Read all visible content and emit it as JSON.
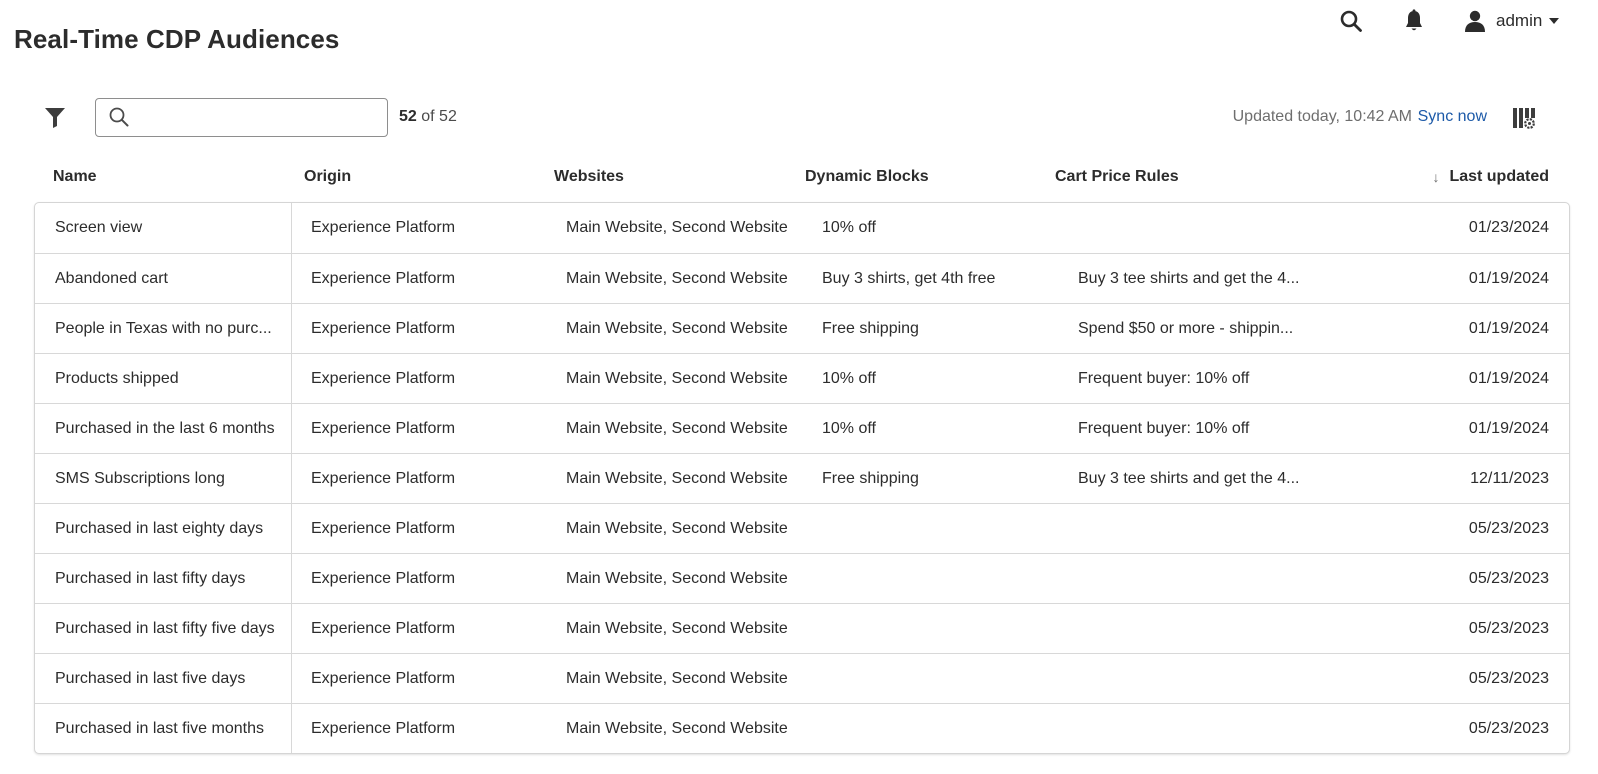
{
  "header": {
    "title": "Real-Time CDP Audiences",
    "icons": [
      "search-icon",
      "bell-icon",
      "user-icon"
    ],
    "user_name": "admin"
  },
  "toolbar": {
    "filter_icon": "filter-icon",
    "search": {
      "value": "",
      "placeholder": ""
    },
    "count_shown": "52",
    "count_total": "of 52",
    "updated_text": "Updated today, 10:42 AM",
    "sync_label": "Sync now",
    "column_settings_icon": "column-settings-icon"
  },
  "table": {
    "columns": [
      {
        "key": "name",
        "label": "Name"
      },
      {
        "key": "origin",
        "label": "Origin"
      },
      {
        "key": "websites",
        "label": "Websites"
      },
      {
        "key": "dynamic_blocks",
        "label": "Dynamic Blocks"
      },
      {
        "key": "cart_price_rules",
        "label": "Cart Price Rules"
      },
      {
        "key": "last_updated",
        "label": "Last updated",
        "sort": "descending"
      }
    ],
    "rows": [
      {
        "name": "Screen view",
        "origin": "Experience Platform",
        "websites": "Main Website, Second Website",
        "dynamic_blocks": "10% off",
        "cart_price_rules": "",
        "last_updated": "01/23/2024"
      },
      {
        "name": "Abandoned cart",
        "origin": "Experience Platform",
        "websites": "Main Website, Second Website",
        "dynamic_blocks": "Buy 3 shirts, get 4th free",
        "cart_price_rules": "Buy 3 tee shirts and get the 4...",
        "last_updated": "01/19/2024"
      },
      {
        "name": "People in Texas with no purc...",
        "origin": "Experience Platform",
        "websites": "Main Website, Second Website",
        "dynamic_blocks": "Free shipping",
        "cart_price_rules": "Spend $50 or more - shippin...",
        "last_updated": "01/19/2024"
      },
      {
        "name": "Products shipped",
        "origin": "Experience Platform",
        "websites": "Main Website, Second Website",
        "dynamic_blocks": "10% off",
        "cart_price_rules": "Frequent buyer: 10% off",
        "last_updated": "01/19/2024"
      },
      {
        "name": "Purchased in the last 6 months",
        "origin": "Experience Platform",
        "websites": "Main Website, Second Website",
        "dynamic_blocks": "10% off",
        "cart_price_rules": "Frequent buyer: 10% off",
        "last_updated": "01/19/2024"
      },
      {
        "name": "SMS Subscriptions long",
        "origin": "Experience Platform",
        "websites": "Main Website, Second Website",
        "dynamic_blocks": "Free shipping",
        "cart_price_rules": "Buy 3 tee shirts and get the 4...",
        "last_updated": "12/11/2023"
      },
      {
        "name": "Purchased in last eighty days",
        "origin": "Experience Platform",
        "websites": "Main Website, Second Website",
        "dynamic_blocks": "",
        "cart_price_rules": "",
        "last_updated": "05/23/2023"
      },
      {
        "name": "Purchased in last fifty days",
        "origin": "Experience Platform",
        "websites": "Main Website, Second Website",
        "dynamic_blocks": "",
        "cart_price_rules": "",
        "last_updated": "05/23/2023"
      },
      {
        "name": "Purchased in last fifty five days",
        "origin": "Experience Platform",
        "websites": "Main Website, Second Website",
        "dynamic_blocks": "",
        "cart_price_rules": "",
        "last_updated": "05/23/2023"
      },
      {
        "name": "Purchased in last five days",
        "origin": "Experience Platform",
        "websites": "Main Website, Second Website",
        "dynamic_blocks": "",
        "cart_price_rules": "",
        "last_updated": "05/23/2023"
      },
      {
        "name": "Purchased in last five months",
        "origin": "Experience Platform",
        "websites": "Main Website, Second Website",
        "dynamic_blocks": "",
        "cart_price_rules": "",
        "last_updated": "05/23/2023"
      }
    ]
  },
  "colors": {
    "link": "#1d5aa8",
    "text": "#2c2c2c",
    "muted": "#6e6e6e",
    "border": "#d8d8d8"
  }
}
